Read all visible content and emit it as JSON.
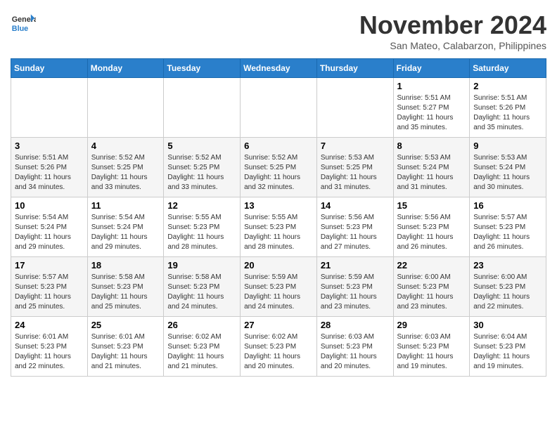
{
  "logo": {
    "text_general": "General",
    "text_blue": "Blue"
  },
  "title": "November 2024",
  "subtitle": "San Mateo, Calabarzon, Philippines",
  "weekdays": [
    "Sunday",
    "Monday",
    "Tuesday",
    "Wednesday",
    "Thursday",
    "Friday",
    "Saturday"
  ],
  "weeks": [
    [
      {
        "day": "",
        "sunrise": "",
        "sunset": "",
        "daylight": ""
      },
      {
        "day": "",
        "sunrise": "",
        "sunset": "",
        "daylight": ""
      },
      {
        "day": "",
        "sunrise": "",
        "sunset": "",
        "daylight": ""
      },
      {
        "day": "",
        "sunrise": "",
        "sunset": "",
        "daylight": ""
      },
      {
        "day": "",
        "sunrise": "",
        "sunset": "",
        "daylight": ""
      },
      {
        "day": "1",
        "sunrise": "Sunrise: 5:51 AM",
        "sunset": "Sunset: 5:27 PM",
        "daylight": "Daylight: 11 hours and 35 minutes."
      },
      {
        "day": "2",
        "sunrise": "Sunrise: 5:51 AM",
        "sunset": "Sunset: 5:26 PM",
        "daylight": "Daylight: 11 hours and 35 minutes."
      }
    ],
    [
      {
        "day": "3",
        "sunrise": "Sunrise: 5:51 AM",
        "sunset": "Sunset: 5:26 PM",
        "daylight": "Daylight: 11 hours and 34 minutes."
      },
      {
        "day": "4",
        "sunrise": "Sunrise: 5:52 AM",
        "sunset": "Sunset: 5:25 PM",
        "daylight": "Daylight: 11 hours and 33 minutes."
      },
      {
        "day": "5",
        "sunrise": "Sunrise: 5:52 AM",
        "sunset": "Sunset: 5:25 PM",
        "daylight": "Daylight: 11 hours and 33 minutes."
      },
      {
        "day": "6",
        "sunrise": "Sunrise: 5:52 AM",
        "sunset": "Sunset: 5:25 PM",
        "daylight": "Daylight: 11 hours and 32 minutes."
      },
      {
        "day": "7",
        "sunrise": "Sunrise: 5:53 AM",
        "sunset": "Sunset: 5:25 PM",
        "daylight": "Daylight: 11 hours and 31 minutes."
      },
      {
        "day": "8",
        "sunrise": "Sunrise: 5:53 AM",
        "sunset": "Sunset: 5:24 PM",
        "daylight": "Daylight: 11 hours and 31 minutes."
      },
      {
        "day": "9",
        "sunrise": "Sunrise: 5:53 AM",
        "sunset": "Sunset: 5:24 PM",
        "daylight": "Daylight: 11 hours and 30 minutes."
      }
    ],
    [
      {
        "day": "10",
        "sunrise": "Sunrise: 5:54 AM",
        "sunset": "Sunset: 5:24 PM",
        "daylight": "Daylight: 11 hours and 29 minutes."
      },
      {
        "day": "11",
        "sunrise": "Sunrise: 5:54 AM",
        "sunset": "Sunset: 5:24 PM",
        "daylight": "Daylight: 11 hours and 29 minutes."
      },
      {
        "day": "12",
        "sunrise": "Sunrise: 5:55 AM",
        "sunset": "Sunset: 5:23 PM",
        "daylight": "Daylight: 11 hours and 28 minutes."
      },
      {
        "day": "13",
        "sunrise": "Sunrise: 5:55 AM",
        "sunset": "Sunset: 5:23 PM",
        "daylight": "Daylight: 11 hours and 28 minutes."
      },
      {
        "day": "14",
        "sunrise": "Sunrise: 5:56 AM",
        "sunset": "Sunset: 5:23 PM",
        "daylight": "Daylight: 11 hours and 27 minutes."
      },
      {
        "day": "15",
        "sunrise": "Sunrise: 5:56 AM",
        "sunset": "Sunset: 5:23 PM",
        "daylight": "Daylight: 11 hours and 26 minutes."
      },
      {
        "day": "16",
        "sunrise": "Sunrise: 5:57 AM",
        "sunset": "Sunset: 5:23 PM",
        "daylight": "Daylight: 11 hours and 26 minutes."
      }
    ],
    [
      {
        "day": "17",
        "sunrise": "Sunrise: 5:57 AM",
        "sunset": "Sunset: 5:23 PM",
        "daylight": "Daylight: 11 hours and 25 minutes."
      },
      {
        "day": "18",
        "sunrise": "Sunrise: 5:58 AM",
        "sunset": "Sunset: 5:23 PM",
        "daylight": "Daylight: 11 hours and 25 minutes."
      },
      {
        "day": "19",
        "sunrise": "Sunrise: 5:58 AM",
        "sunset": "Sunset: 5:23 PM",
        "daylight": "Daylight: 11 hours and 24 minutes."
      },
      {
        "day": "20",
        "sunrise": "Sunrise: 5:59 AM",
        "sunset": "Sunset: 5:23 PM",
        "daylight": "Daylight: 11 hours and 24 minutes."
      },
      {
        "day": "21",
        "sunrise": "Sunrise: 5:59 AM",
        "sunset": "Sunset: 5:23 PM",
        "daylight": "Daylight: 11 hours and 23 minutes."
      },
      {
        "day": "22",
        "sunrise": "Sunrise: 6:00 AM",
        "sunset": "Sunset: 5:23 PM",
        "daylight": "Daylight: 11 hours and 23 minutes."
      },
      {
        "day": "23",
        "sunrise": "Sunrise: 6:00 AM",
        "sunset": "Sunset: 5:23 PM",
        "daylight": "Daylight: 11 hours and 22 minutes."
      }
    ],
    [
      {
        "day": "24",
        "sunrise": "Sunrise: 6:01 AM",
        "sunset": "Sunset: 5:23 PM",
        "daylight": "Daylight: 11 hours and 22 minutes."
      },
      {
        "day": "25",
        "sunrise": "Sunrise: 6:01 AM",
        "sunset": "Sunset: 5:23 PM",
        "daylight": "Daylight: 11 hours and 21 minutes."
      },
      {
        "day": "26",
        "sunrise": "Sunrise: 6:02 AM",
        "sunset": "Sunset: 5:23 PM",
        "daylight": "Daylight: 11 hours and 21 minutes."
      },
      {
        "day": "27",
        "sunrise": "Sunrise: 6:02 AM",
        "sunset": "Sunset: 5:23 PM",
        "daylight": "Daylight: 11 hours and 20 minutes."
      },
      {
        "day": "28",
        "sunrise": "Sunrise: 6:03 AM",
        "sunset": "Sunset: 5:23 PM",
        "daylight": "Daylight: 11 hours and 20 minutes."
      },
      {
        "day": "29",
        "sunrise": "Sunrise: 6:03 AM",
        "sunset": "Sunset: 5:23 PM",
        "daylight": "Daylight: 11 hours and 19 minutes."
      },
      {
        "day": "30",
        "sunrise": "Sunrise: 6:04 AM",
        "sunset": "Sunset: 5:23 PM",
        "daylight": "Daylight: 11 hours and 19 minutes."
      }
    ]
  ]
}
